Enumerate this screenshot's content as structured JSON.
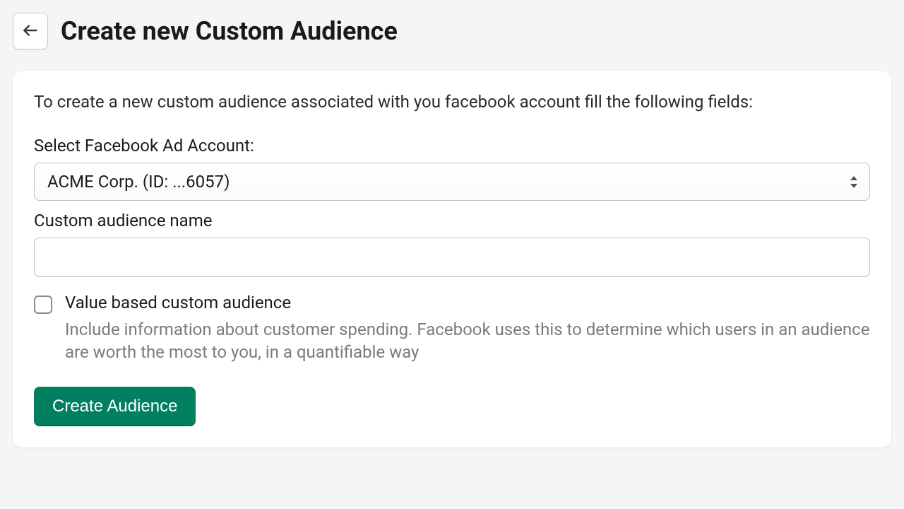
{
  "header": {
    "title": "Create new Custom Audience"
  },
  "form": {
    "intro": "To create a new custom audience associated with you facebook account fill the following fields:",
    "ad_account_label": "Select Facebook Ad Account:",
    "ad_account_selected": "ACME Corp. (ID: ...6057)",
    "audience_name_label": "Custom audience name",
    "audience_name_value": "",
    "value_based": {
      "label": "Value based custom audience",
      "description": "Include information about customer spending. Facebook uses this to determine which users in an audience are worth the most to you, in a quantifiable way",
      "checked": false
    },
    "submit_label": "Create Audience"
  }
}
